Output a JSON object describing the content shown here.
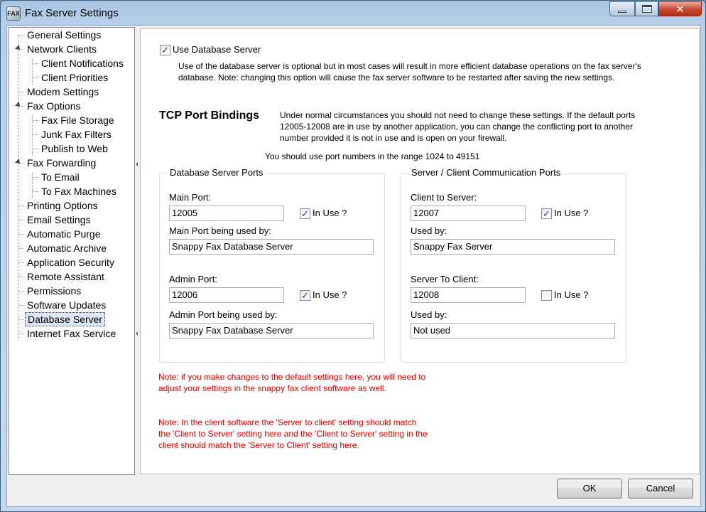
{
  "window": {
    "title": "Fax Server Settings",
    "icon": "fax-app-icon",
    "icon_text": "FAX"
  },
  "titlebar_controls": {
    "minimize": "minimize-icon",
    "maximize": "maximize-icon",
    "close_glyph": "✕"
  },
  "sidebar": {
    "items": [
      {
        "label": "General Settings",
        "level": 0
      },
      {
        "label": "Network Clients",
        "level": 0,
        "expanded": true
      },
      {
        "label": "Client Notifications",
        "level": 1
      },
      {
        "label": "Client Priorities",
        "level": 1
      },
      {
        "label": "Modem Settings",
        "level": 0
      },
      {
        "label": "Fax Options",
        "level": 0,
        "expanded": true
      },
      {
        "label": "Fax File Storage",
        "level": 1
      },
      {
        "label": "Junk Fax Filters",
        "level": 1
      },
      {
        "label": "Publish to Web",
        "level": 1
      },
      {
        "label": "Fax Forwarding",
        "level": 0,
        "expanded": true
      },
      {
        "label": "To Email",
        "level": 1
      },
      {
        "label": "To Fax Machines",
        "level": 1
      },
      {
        "label": "Printing Options",
        "level": 0
      },
      {
        "label": "Email Settings",
        "level": 0
      },
      {
        "label": "Automatic Purge",
        "level": 0
      },
      {
        "label": "Automatic Archive",
        "level": 0
      },
      {
        "label": "Application Security",
        "level": 0
      },
      {
        "label": "Remote Assistant",
        "level": 0
      },
      {
        "label": "Permissions",
        "level": 0
      },
      {
        "label": "Software Updates",
        "level": 0
      },
      {
        "label": "Database Server",
        "level": 0,
        "selected": true
      },
      {
        "label": "Internet Fax Service",
        "level": 0
      }
    ]
  },
  "main": {
    "use_db": {
      "label": "Use Database Server",
      "checked": true,
      "description": "Use of the database server is optional but in most cases will result in more efficient database operations on the fax server's database.  Note: changing this option will cause the fax server software to be restarted after saving the new settings."
    },
    "tcp": {
      "heading": "TCP Port Bindings",
      "description": "Under normal circumstances you should not need to change these settings.  If the default ports 12005-12008 are in use by another application, you can change the conflicting port to another number provided it is not in use and is open on your firewall.",
      "range_note": "You should use port numbers in the range 1024 to 49151"
    },
    "db_ports": {
      "legend": "Database Server Ports",
      "main_port_label": "Main Port:",
      "main_port_value": "12005",
      "main_in_use_label": "In Use ?",
      "main_in_use_checked": true,
      "main_used_by_label": "Main Port being used by:",
      "main_used_by_value": "Snappy Fax Database Server",
      "admin_port_label": "Admin Port:",
      "admin_port_value": "12006",
      "admin_in_use_label": "In Use ?",
      "admin_in_use_checked": true,
      "admin_used_by_label": "Admin Port being used by:",
      "admin_used_by_value": "Snappy Fax Database Server"
    },
    "comm_ports": {
      "legend": "Server / Client Communication Ports",
      "c2s_label": "Client to Server:",
      "c2s_value": "12007",
      "c2s_in_use_label": "In Use ?",
      "c2s_in_use_checked": true,
      "c2s_used_by_label": "Used by:",
      "c2s_used_by_value": "Snappy Fax Server",
      "s2c_label": "Server To Client:",
      "s2c_value": "12008",
      "s2c_in_use_label": "In Use ?",
      "s2c_in_use_checked": false,
      "s2c_used_by_label": "Used by:",
      "s2c_used_by_value": "Not used"
    },
    "notes": {
      "note1": "Note: if you make changes to the default settings here, you will need to adjust your settings in the snappy fax client software as well.",
      "note2": "Note: In the client software the 'Server to client' setting should match the 'Client to Server' setting here and the 'Client to Server' setting in the client should match the 'Server to Client' setting here."
    }
  },
  "buttons": {
    "ok": "OK",
    "cancel": "Cancel"
  },
  "colors": {
    "note_red": "#e00000",
    "selected_bg": "#dde6f3",
    "title_gradient_top": "#a9c5e3",
    "close_red": "#c9462f"
  }
}
